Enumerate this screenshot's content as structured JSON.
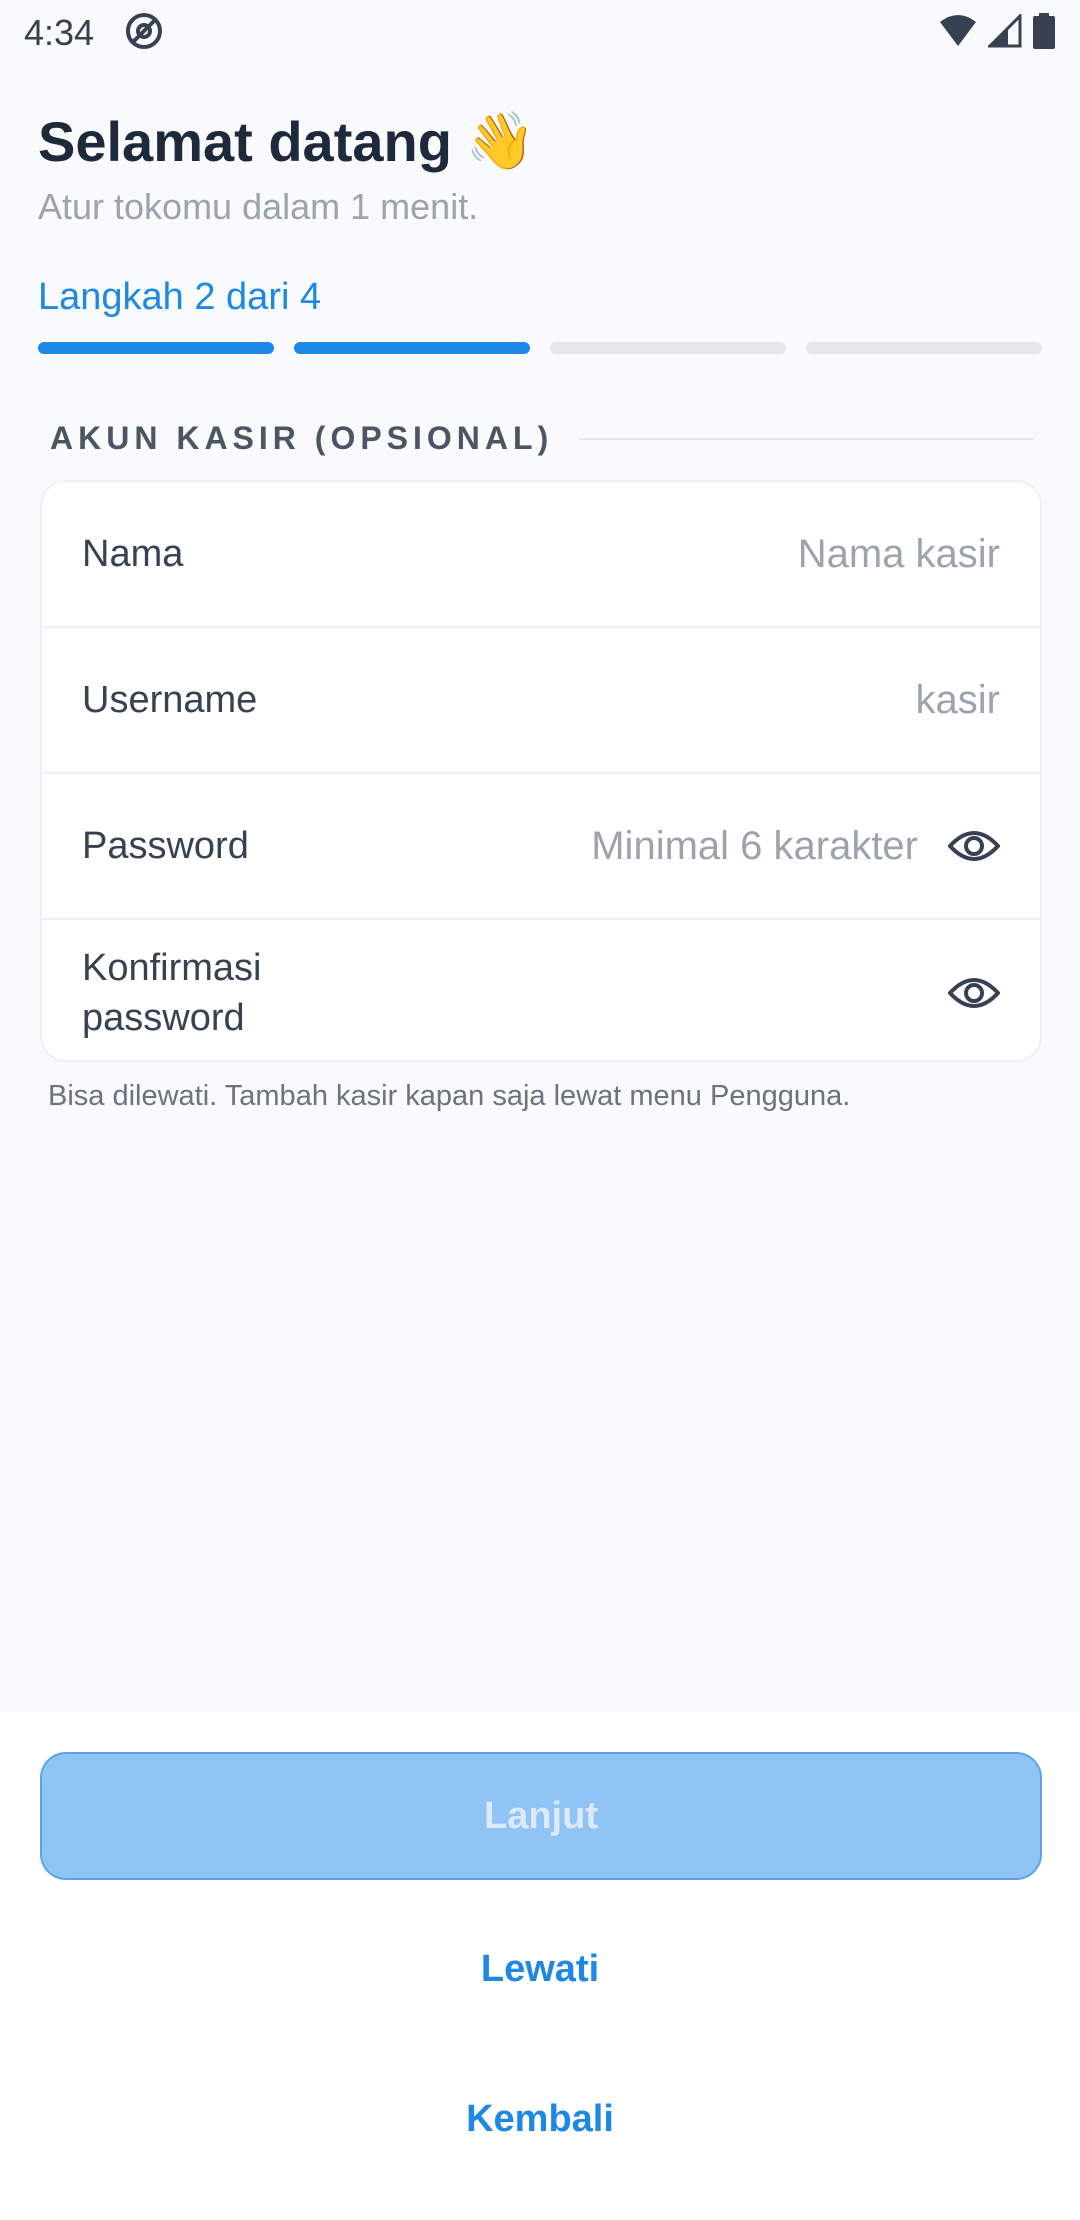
{
  "status_bar": {
    "time": "4:34",
    "icons": [
      "at-sign-icon",
      "wifi-icon",
      "signal-icon",
      "battery-icon"
    ]
  },
  "header": {
    "title": "Selamat datang",
    "emoji": "👋",
    "subtitle": "Atur tokomu dalam 1 menit.",
    "step_label": "Langkah 2 dari 4",
    "step_current": 2,
    "step_total": 4
  },
  "section": {
    "title": "AKUN KASIR (OPSIONAL)",
    "fields": [
      {
        "label": "Nama",
        "value": "",
        "placeholder": "Nama kasir",
        "has_eye": false
      },
      {
        "label": "Username",
        "value": "",
        "placeholder": "kasir",
        "has_eye": false
      },
      {
        "label": "Password",
        "value": "",
        "placeholder": "Minimal 6 karakter",
        "has_eye": true
      },
      {
        "label": "Konfirmasi password",
        "value": "",
        "placeholder": "",
        "has_eye": true
      }
    ],
    "hint": "Bisa dilewati. Tambah kasir kapan saja lewat menu Pengguna."
  },
  "actions": {
    "next_label": "Lanjut",
    "skip_label": "Lewati",
    "back_label": "Kembali"
  },
  "colors": {
    "accent": "#1e88e5",
    "disabled_button": "#90c4f5",
    "background": "#f8fafc"
  }
}
